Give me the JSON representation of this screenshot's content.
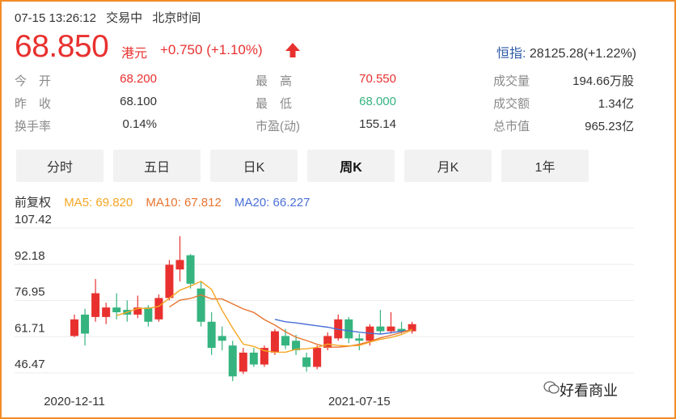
{
  "header": {
    "datetime": "07-15 13:26:12",
    "trading_status": "交易中",
    "timezone": "北京时间",
    "price": "68.850",
    "currency": "港元",
    "change": "+0.750 (+1.10%)",
    "index_label": "恒指:",
    "index_value": "28125.28(+1.22%)"
  },
  "stats": [
    {
      "label": "今　开",
      "value": "68.200",
      "color": "#e8312f"
    },
    {
      "label": "昨　收",
      "value": "68.100",
      "color": "#333333"
    },
    {
      "label": "换手率",
      "value": "0.14%",
      "color": "#333333"
    },
    {
      "label": "最　高",
      "value": "70.550",
      "color": "#e8312f"
    },
    {
      "label": "最　低",
      "value": "68.000",
      "color": "#35b47f"
    },
    {
      "label": "市盈(动)",
      "value": "155.14",
      "color": "#333333"
    },
    {
      "label": "成交量",
      "value": "194.66万股",
      "color": "#333333"
    },
    {
      "label": "成交额",
      "value": "1.34亿",
      "color": "#333333"
    },
    {
      "label": "总市值",
      "value": "965.23亿",
      "color": "#333333"
    }
  ],
  "tabs": [
    {
      "label": "分时",
      "active": false
    },
    {
      "label": "五日",
      "active": false
    },
    {
      "label": "日K",
      "active": false
    },
    {
      "label": "周K",
      "active": true
    },
    {
      "label": "月K",
      "active": false
    },
    {
      "label": "1年",
      "active": false
    }
  ],
  "ma_legend": {
    "adjust": "前复权",
    "ma5": "MA5: 69.820",
    "ma10": "MA10: 67.812",
    "ma20": "MA20: 66.227"
  },
  "colors": {
    "up": "#e8312f",
    "down": "#35b47f",
    "ma5": "#f5a623",
    "ma10": "#e8742f",
    "ma20": "#4a6fd6",
    "index_label": "#2d5aa7"
  },
  "watermark": "好看商业",
  "chart_data": {
    "type": "candlestick",
    "y_ticks": [
      "107.42",
      "92.18",
      "76.95",
      "61.71",
      "46.47"
    ],
    "ylim": [
      46.47,
      107.42
    ],
    "x_labels": [
      {
        "index": 0,
        "label": "2020-12-11"
      },
      {
        "index": 27,
        "label": "2021-07-15"
      }
    ],
    "candles": [
      {
        "o": 62.0,
        "c": 69.0,
        "h": 71.0,
        "l": 61.5
      },
      {
        "o": 71.0,
        "c": 63.0,
        "h": 73.5,
        "l": 58.0
      },
      {
        "o": 70.0,
        "c": 80.0,
        "h": 86.0,
        "l": 68.0
      },
      {
        "o": 70.0,
        "c": 74.0,
        "h": 76.0,
        "l": 67.0
      },
      {
        "o": 74.0,
        "c": 72.0,
        "h": 80.0,
        "l": 69.0
      },
      {
        "o": 73.0,
        "c": 71.0,
        "h": 77.0,
        "l": 68.0
      },
      {
        "o": 71.0,
        "c": 74.0,
        "h": 79.0,
        "l": 69.5
      },
      {
        "o": 74.0,
        "c": 68.0,
        "h": 75.0,
        "l": 66.0
      },
      {
        "o": 69.0,
        "c": 78.0,
        "h": 79.5,
        "l": 68.0
      },
      {
        "o": 78.0,
        "c": 92.0,
        "h": 94.0,
        "l": 77.0
      },
      {
        "o": 90.0,
        "c": 94.0,
        "h": 104.0,
        "l": 85.0
      },
      {
        "o": 96.0,
        "c": 84.0,
        "h": 96.5,
        "l": 82.0
      },
      {
        "o": 82.0,
        "c": 68.0,
        "h": 85.0,
        "l": 66.0
      },
      {
        "o": 68.0,
        "c": 57.0,
        "h": 72.0,
        "l": 54.0
      },
      {
        "o": 62.0,
        "c": 60.0,
        "h": 66.0,
        "l": 56.0
      },
      {
        "o": 58.0,
        "c": 45.0,
        "h": 60.0,
        "l": 43.0
      },
      {
        "o": 47.0,
        "c": 55.0,
        "h": 57.0,
        "l": 46.0
      },
      {
        "o": 55.0,
        "c": 50.0,
        "h": 57.0,
        "l": 49.0
      },
      {
        "o": 50.0,
        "c": 57.0,
        "h": 58.0,
        "l": 49.0
      },
      {
        "o": 55.0,
        "c": 64.0,
        "h": 65.0,
        "l": 54.0
      },
      {
        "o": 62.0,
        "c": 58.0,
        "h": 65.0,
        "l": 56.5
      },
      {
        "o": 60.0,
        "c": 56.0,
        "h": 62.5,
        "l": 54.0
      },
      {
        "o": 53.0,
        "c": 49.0,
        "h": 55.0,
        "l": 47.0
      },
      {
        "o": 49.0,
        "c": 57.0,
        "h": 58.0,
        "l": 48.0
      },
      {
        "o": 57.0,
        "c": 62.0,
        "h": 63.5,
        "l": 56.0
      },
      {
        "o": 61.0,
        "c": 69.0,
        "h": 71.0,
        "l": 60.0
      },
      {
        "o": 69.0,
        "c": 61.0,
        "h": 70.0,
        "l": 59.0
      },
      {
        "o": 61.0,
        "c": 60.0,
        "h": 63.0,
        "l": 56.0
      },
      {
        "o": 60.0,
        "c": 66.0,
        "h": 67.0,
        "l": 58.0
      },
      {
        "o": 66.0,
        "c": 64.0,
        "h": 73.0,
        "l": 63.0
      },
      {
        "o": 64.0,
        "c": 66.0,
        "h": 72.0,
        "l": 63.0
      },
      {
        "o": 65.0,
        "c": 64.0,
        "h": 68.0,
        "l": 63.0
      },
      {
        "o": 64.0,
        "c": 67.0,
        "h": 68.0,
        "l": 63.0
      }
    ],
    "ma5": [
      null,
      null,
      null,
      null,
      70.6,
      72.0,
      73.6,
      73.6,
      74.5,
      77.9,
      81.3,
      83.0,
      85.0,
      81.6,
      72.8,
      65.3,
      58.6,
      57.6,
      55.8,
      55.2,
      55.2,
      56.4,
      56.6,
      57.2,
      58.6,
      58.0,
      57.8,
      58.0,
      59.4,
      60.6,
      61.4,
      62.6,
      64.6
    ],
    "ma10": [
      null,
      null,
      null,
      null,
      null,
      null,
      null,
      null,
      null,
      74.2,
      77.1,
      77.8,
      79.3,
      77.6,
      77.6,
      75.5,
      73.4,
      71.9,
      68.9,
      66.6,
      63.8,
      61.5,
      60.1,
      58.5,
      57.3,
      57.3,
      57.7,
      58.5,
      59.7,
      61.2,
      62.3,
      63.5,
      64.9
    ],
    "ma20": [
      null,
      null,
      null,
      null,
      null,
      null,
      null,
      null,
      null,
      null,
      null,
      null,
      null,
      null,
      null,
      null,
      null,
      null,
      null,
      69.0,
      68.0,
      67.5,
      66.9,
      66.3,
      65.7,
      64.8,
      64.2,
      63.6,
      63.2,
      62.8,
      63.4,
      64.0,
      64.4
    ]
  }
}
